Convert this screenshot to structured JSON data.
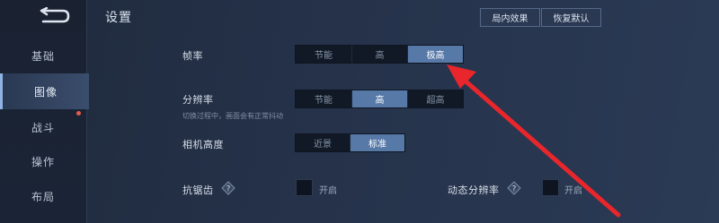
{
  "header": {
    "title": "设置",
    "btn_effects": "局内效果",
    "btn_reset": "恢复默认"
  },
  "sidebar": {
    "items": [
      {
        "label": "基础"
      },
      {
        "label": "图像"
      },
      {
        "label": "战斗"
      },
      {
        "label": "操作"
      },
      {
        "label": "布局"
      }
    ],
    "active_index": 1
  },
  "settings": {
    "frame_rate": {
      "label": "帧率",
      "options": [
        "节能",
        "高",
        "极高"
      ],
      "selected": "极高"
    },
    "resolution": {
      "label": "分辨率",
      "options": [
        "节能",
        "高",
        "超高"
      ],
      "selected": "高",
      "hint": "切换过程中，画面会有正常抖动"
    },
    "camera_height": {
      "label": "相机高度",
      "options": [
        "近景",
        "标准"
      ],
      "selected": "标准"
    },
    "anti_aliasing": {
      "label": "抗锯齿",
      "toggle_label": "开启",
      "checked": false
    },
    "dynamic_resolution": {
      "label": "动态分辨率",
      "toggle_label": "开启",
      "checked": false
    }
  },
  "colors": {
    "accent_selected": "#5779a8",
    "annotation_arrow": "#e8262b"
  }
}
